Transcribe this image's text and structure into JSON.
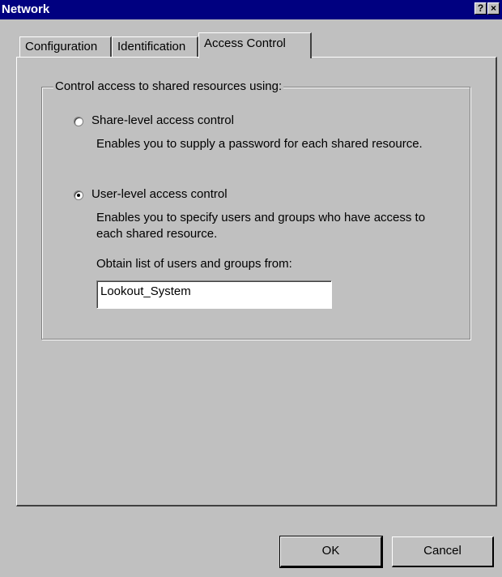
{
  "window": {
    "title": "Network",
    "help_icon": "question-mark-icon",
    "close_icon": "close-x-icon",
    "help_glyph": "?",
    "close_glyph": "×"
  },
  "tabs": [
    {
      "label": "Configuration",
      "selected": false
    },
    {
      "label": "Identification",
      "selected": false
    },
    {
      "label": "Access Control",
      "selected": true
    }
  ],
  "access_control": {
    "group_label": "Control access to shared resources using:",
    "options": [
      {
        "label": "Share-level access control",
        "selected": false,
        "description": "Enables you to supply a password for each shared resource."
      },
      {
        "label": "User-level access control",
        "selected": true,
        "description": "Enables you to specify users and groups who have access to each shared resource."
      }
    ],
    "obtain_label": "Obtain list of users and groups from:",
    "obtain_value": "Lookout_System"
  },
  "buttons": {
    "ok": "OK",
    "cancel": "Cancel"
  },
  "colors": {
    "titlebar": "#000080",
    "face": "#c0c0c0"
  }
}
